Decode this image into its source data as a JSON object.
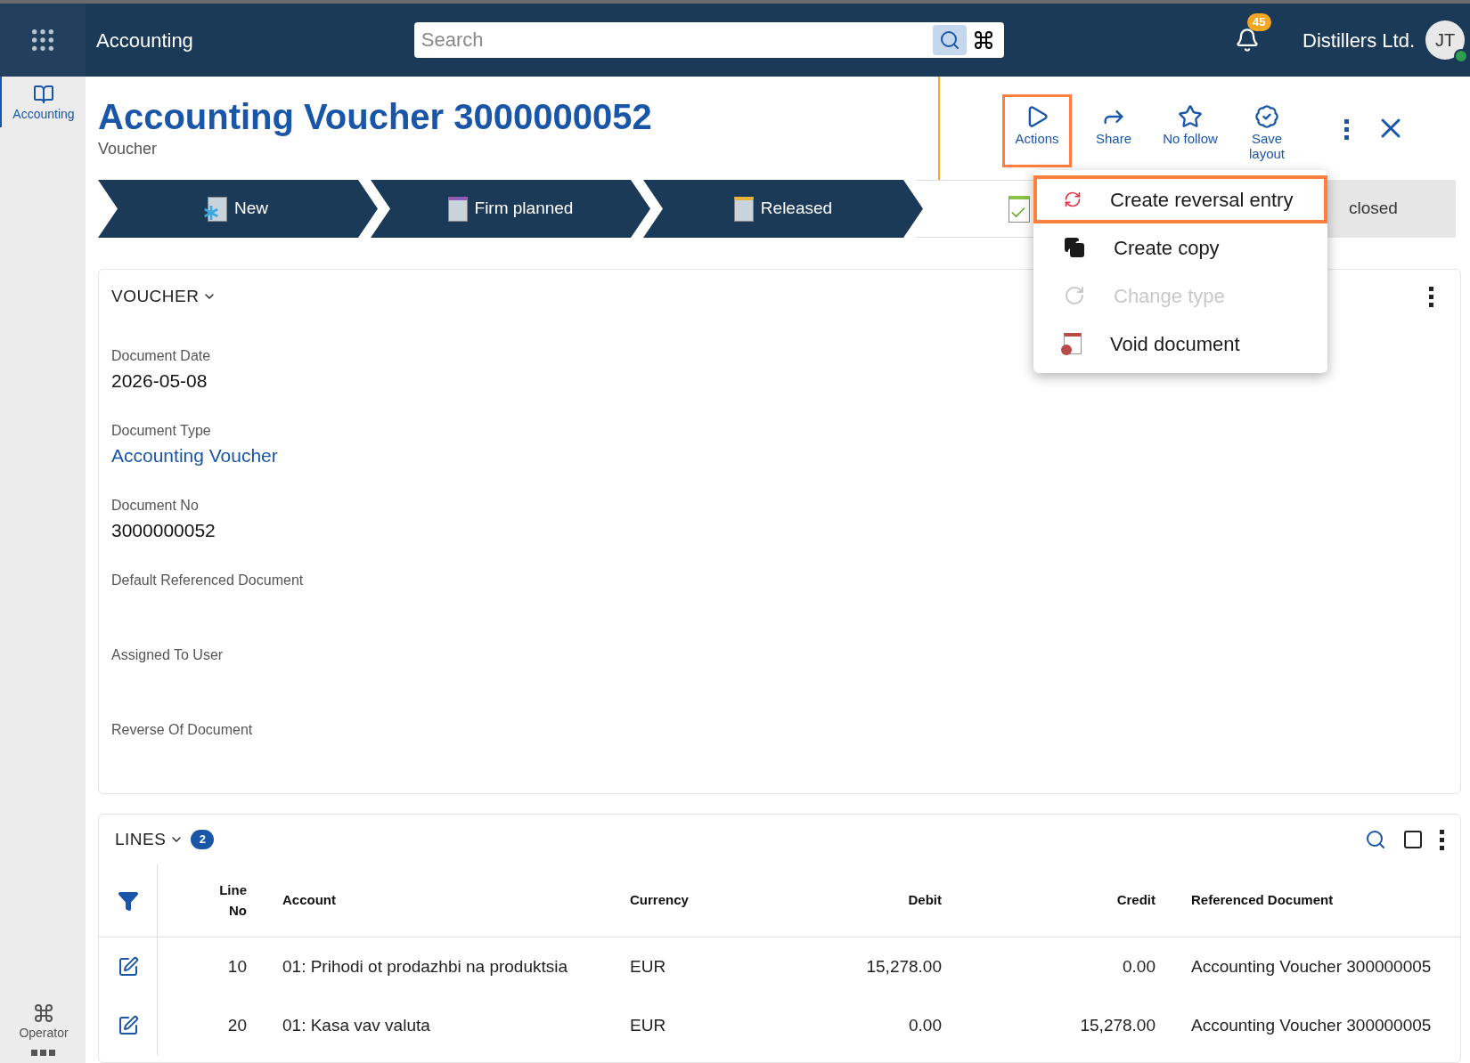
{
  "topbar": {
    "app_title": "Accounting",
    "search": {
      "placeholder": "Search"
    },
    "notifications": "45",
    "company": "Distillers Ltd.",
    "avatar": "JT"
  },
  "sidebar": {
    "items": [
      {
        "label": "Accounting",
        "kind": "book",
        "selected": true
      },
      {
        "label": "Operator",
        "kind": "command",
        "selected": false
      }
    ]
  },
  "header": {
    "title": "Accounting Voucher 3000000052",
    "subtitle": "Voucher"
  },
  "toolbar": [
    {
      "label": "Actions",
      "kind": "play",
      "highlighted": true
    },
    {
      "label": "Share",
      "kind": "share",
      "highlighted": false
    },
    {
      "label": "No follow",
      "kind": "star",
      "highlighted": false
    },
    {
      "label": "Save layout",
      "kind": "badge",
      "highlighted": false
    }
  ],
  "steps": [
    {
      "label": "New",
      "completed": true,
      "selected": false,
      "kind": "new"
    },
    {
      "label": "Firm planned",
      "completed": true,
      "selected": false,
      "kind": "pin"
    },
    {
      "label": "Released",
      "completed": true,
      "selected": false,
      "kind": "plane"
    },
    {
      "completed": false,
      "selected": true,
      "kind": "check"
    },
    {
      "label": "closed",
      "completed": false,
      "selected": false,
      "kind": "none"
    }
  ],
  "actions_menu": [
    {
      "label": "Create reversal entry",
      "kind": "reverse",
      "disabled": false,
      "highlighted": true
    },
    {
      "label": "Create copy",
      "kind": "copy",
      "disabled": false,
      "highlighted": false
    },
    {
      "label": "Change type",
      "kind": "refresh",
      "disabled": true,
      "highlighted": false
    },
    {
      "label": "Void document",
      "kind": "void",
      "disabled": false,
      "highlighted": false
    }
  ],
  "voucher": {
    "title": "VOUCHER",
    "fields": [
      {
        "label": "Document Date",
        "value": "2026-05-08",
        "link": false
      },
      {
        "label": "Document Type",
        "value": "Accounting Voucher",
        "link": true
      },
      {
        "label": "Document No",
        "value": "3000000052",
        "link": false
      },
      {
        "label": "Default Referenced Document"
      },
      {
        "label": "Assigned To User"
      },
      {
        "label": "Reverse Of Document"
      }
    ]
  },
  "lines": {
    "title": "LINES",
    "count": "2",
    "columns": [
      "Line No",
      "Account",
      "Currency",
      "Debit",
      "Credit",
      "Referenced Document"
    ],
    "rows": [
      [
        "10",
        "01: Prihodi ot prodazhbi na produktsia",
        "EUR",
        "15,278.00",
        "0.00",
        "Accounting Voucher 300000005"
      ],
      [
        "20",
        "01: Kasa vav valuta",
        "EUR",
        "0.00",
        "15,278.00",
        "Accounting Voucher 300000005"
      ]
    ]
  }
}
